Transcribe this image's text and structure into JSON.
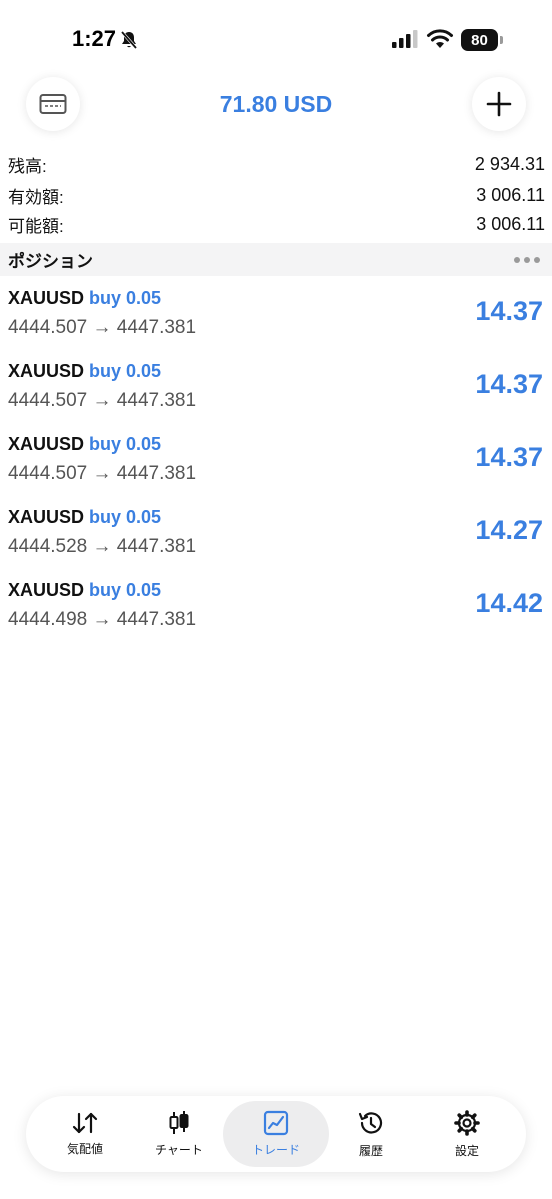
{
  "status_bar": {
    "time": "1:27",
    "battery": "80"
  },
  "header": {
    "title": "71.80 USD"
  },
  "summary": [
    {
      "label": "残高:",
      "value": "2 934.31"
    },
    {
      "label": "有効額:",
      "value": "3 006.11"
    },
    {
      "label": "可能額:",
      "value": "3 006.11"
    }
  ],
  "positions_section": {
    "title": "ポジション"
  },
  "positions": [
    {
      "symbol": "XAUUSD",
      "side": "buy 0.05",
      "prices": "4444.507 → 4447.381",
      "profit": "14.37"
    },
    {
      "symbol": "XAUUSD",
      "side": "buy 0.05",
      "prices": "4444.507 → 4447.381",
      "profit": "14.37"
    },
    {
      "symbol": "XAUUSD",
      "side": "buy 0.05",
      "prices": "4444.507 → 4447.381",
      "profit": "14.37"
    },
    {
      "symbol": "XAUUSD",
      "side": "buy 0.05",
      "prices": "4444.528 → 4447.381",
      "profit": "14.27"
    },
    {
      "symbol": "XAUUSD",
      "side": "buy 0.05",
      "prices": "4444.498 → 4447.381",
      "profit": "14.42"
    }
  ],
  "tabs": [
    {
      "label": "気配値",
      "icon": "quotes-arrows-icon"
    },
    {
      "label": "チャート",
      "icon": "candlestick-icon"
    },
    {
      "label": "トレード",
      "icon": "trade-chart-icon",
      "active": true
    },
    {
      "label": "履歴",
      "icon": "history-clock-icon"
    },
    {
      "label": "設定",
      "icon": "gear-icon"
    }
  ],
  "colors": {
    "accent": "#3a7fe0",
    "section_bg": "#f4f4f5",
    "text": "#111111",
    "secondary_text": "#555555"
  }
}
